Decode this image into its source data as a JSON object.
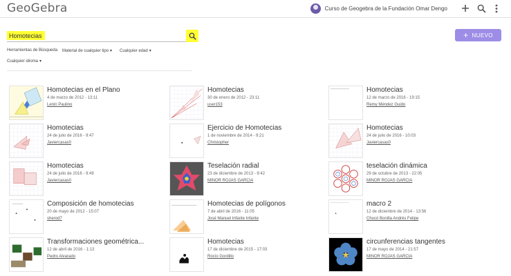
{
  "app": {
    "logo": "GeoGebra"
  },
  "header": {
    "user_name": "Curso de Geogebra de la Fundación Omar Dengo"
  },
  "search": {
    "value": "Homotecias",
    "placeholder": ""
  },
  "new_button": {
    "label": "NUEVO"
  },
  "filters": {
    "tools": "Herramientas de Búsqueda",
    "material_type": "Material de cualquier tipo",
    "age": "Cualquier edad",
    "language": "Cualquier idioma"
  },
  "colors": {
    "accent": "#9d8de6",
    "highlight": "#ffff33"
  },
  "results": [
    {
      "title": "Homotecias en el Plano",
      "date": "4 de marzo de 2012 - 13:11",
      "author": "Lenin Paulino",
      "thumb": "plano"
    },
    {
      "title": "Homotecias",
      "date": "30 de enero de 2012 - 23:11",
      "author": "user153",
      "thumb": "rays"
    },
    {
      "title": "Homotecias",
      "date": "12 de marzo de 2016 - 19:15",
      "author": "Remy Méndez Guido",
      "thumb": "blank"
    },
    {
      "title": "Homotecias",
      "date": "24 de julio de 2016 - 9:47",
      "author": "Javiercasas0",
      "thumb": "tri"
    },
    {
      "title": "Ejercicio de Homotecias",
      "date": "1 de noviembre de 2014 - 9:21",
      "author": "Christopher",
      "thumb": "exercise"
    },
    {
      "title": "Homotecias",
      "date": "24 de julio de 2016 - 10:03",
      "author": "Javiercasas0",
      "thumb": "tri2"
    },
    {
      "title": "Homotecias",
      "date": "24 de julio de 2016 - 9:49",
      "author": "Javiercasas0",
      "thumb": "squares"
    },
    {
      "title": "Teselación radial",
      "date": "23 de diciembre de 2013 - 9:42",
      "author": "MINOR ROJAS GARCIA",
      "thumb": "radial"
    },
    {
      "title": "teselación dinámica",
      "date": "29 de octubre de 2013 - 22:05",
      "author": "MINOR ROJAS GARCIA",
      "thumb": "hexes"
    },
    {
      "title": "Composición de homotecias",
      "date": "20 de mayo de 2012 - 15:07",
      "author": "sherod7",
      "thumb": "composition"
    },
    {
      "title": "Homotecias de polígonos",
      "date": "7 de abril de 2016 - 11:05",
      "author": "José Manuel Infante Infante",
      "thumb": "polygons"
    },
    {
      "title": "macro 2",
      "date": "12 de diciembre de 2014 - 13:56",
      "author": "Chocó Bonilla Andrés Felipe",
      "thumb": "macro"
    },
    {
      "title": "Transformaciones geométrica...",
      "date": "12 de abril de 2016 - 1:13",
      "author": "Pedro Alvarado",
      "thumb": "photo"
    },
    {
      "title": "Homotecias",
      "date": "17 de diciembre de 2015 - 17:03",
      "author": "Rocío Gordillo",
      "thumb": "silhouette"
    },
    {
      "title": "circunferencias tangentes",
      "date": "17 de mayo de 2014 - 21:57",
      "author": "MINOR ROJAS GARCIA",
      "thumb": "flower"
    }
  ]
}
